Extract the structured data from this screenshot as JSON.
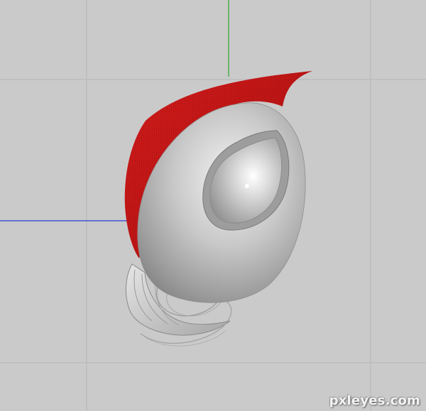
{
  "viewport": {
    "background_color": "#cacaca",
    "grid_color": "#b7b7b7",
    "axis_y_color": "#2aa52a",
    "axis_x_color": "#2b3fd6"
  },
  "model": {
    "body_color": "#bdbdbd",
    "hood_color": "#c41414",
    "wire_color": "#9a9a9a"
  },
  "watermark": {
    "text": "pxleyes.com"
  }
}
